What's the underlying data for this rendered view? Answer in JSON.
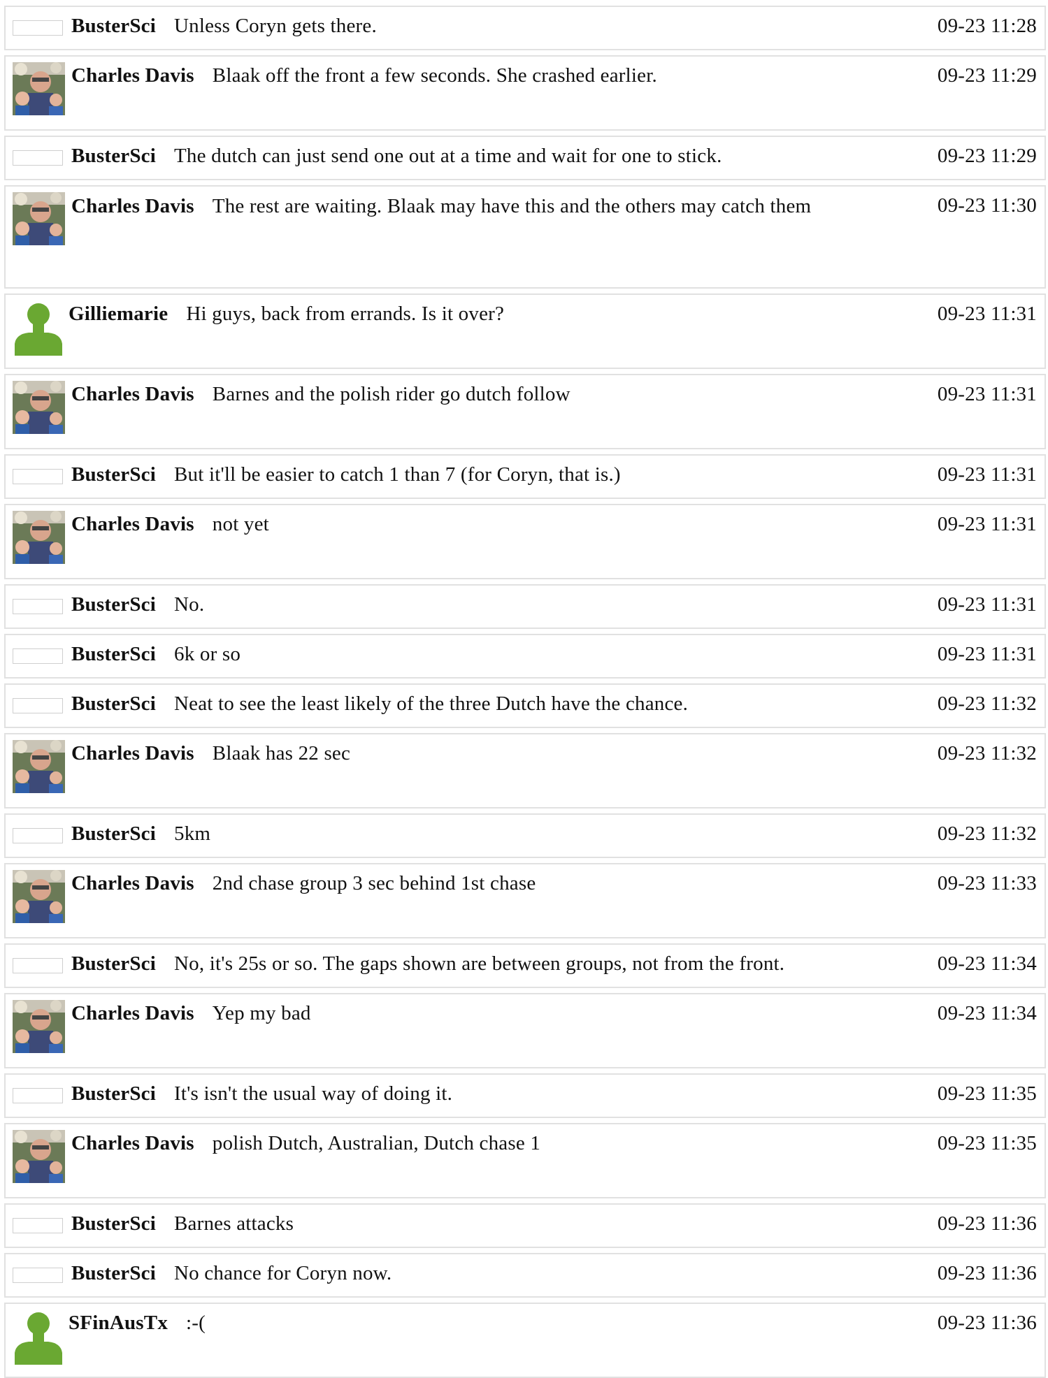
{
  "messages": [
    {
      "user": "BusterSci",
      "avatar": "blank",
      "text": "Unless Coryn gets there.",
      "time": "09-23 11:28"
    },
    {
      "user": "Charles Davis",
      "avatar": "photo",
      "text": "Blaak off the front a few seconds. She crashed earlier.",
      "time": "09-23 11:29"
    },
    {
      "user": "BusterSci",
      "avatar": "blank",
      "text": "The dutch can just send one out at a time and wait for one to stick.",
      "time": "09-23 11:29"
    },
    {
      "user": "Charles Davis",
      "avatar": "photo",
      "text": "The rest are waiting. Blaak may have this and the others may catch them",
      "time": "09-23 11:30"
    },
    {
      "user": "Gilliemarie",
      "avatar": "person",
      "text": "Hi guys, back from errands. Is it over?",
      "time": "09-23 11:31"
    },
    {
      "user": "Charles Davis",
      "avatar": "photo",
      "text": "Barnes and the polish rider go dutch follow",
      "time": "09-23 11:31"
    },
    {
      "user": "BusterSci",
      "avatar": "blank",
      "text": "But it'll be easier to catch 1 than 7 (for Coryn, that is.)",
      "time": "09-23 11:31"
    },
    {
      "user": "Charles Davis",
      "avatar": "photo",
      "text": "not yet",
      "time": "09-23 11:31"
    },
    {
      "user": "BusterSci",
      "avatar": "blank",
      "text": "No.",
      "time": "09-23 11:31"
    },
    {
      "user": "BusterSci",
      "avatar": "blank",
      "text": "6k or so",
      "time": "09-23 11:31"
    },
    {
      "user": "BusterSci",
      "avatar": "blank",
      "text": "Neat to see the least likely of the three Dutch have the chance.",
      "time": "09-23 11:32"
    },
    {
      "user": "Charles Davis",
      "avatar": "photo",
      "text": "Blaak has 22 sec",
      "time": "09-23 11:32"
    },
    {
      "user": "BusterSci",
      "avatar": "blank",
      "text": "5km",
      "time": "09-23 11:32"
    },
    {
      "user": "Charles Davis",
      "avatar": "photo",
      "text": "2nd chase group 3 sec behind 1st chase",
      "time": "09-23 11:33"
    },
    {
      "user": "BusterSci",
      "avatar": "blank",
      "text": "No, it's 25s or so. The gaps shown are between groups, not from the front.",
      "time": "09-23 11:34"
    },
    {
      "user": "Charles Davis",
      "avatar": "photo",
      "text": "Yep my bad",
      "time": "09-23 11:34"
    },
    {
      "user": "BusterSci",
      "avatar": "blank",
      "text": "It's isn't the usual way of doing it.",
      "time": "09-23 11:35"
    },
    {
      "user": "Charles Davis",
      "avatar": "photo",
      "text": "polish Dutch, Australian, Dutch chase 1",
      "time": "09-23 11:35"
    },
    {
      "user": "BusterSci",
      "avatar": "blank",
      "text": "Barnes attacks",
      "time": "09-23 11:36"
    },
    {
      "user": "BusterSci",
      "avatar": "blank",
      "text": "No chance for Coryn now.",
      "time": "09-23 11:36"
    },
    {
      "user": "SFinAusTx",
      "avatar": "person",
      "text": ":-(",
      "time": "09-23 11:36"
    }
  ]
}
